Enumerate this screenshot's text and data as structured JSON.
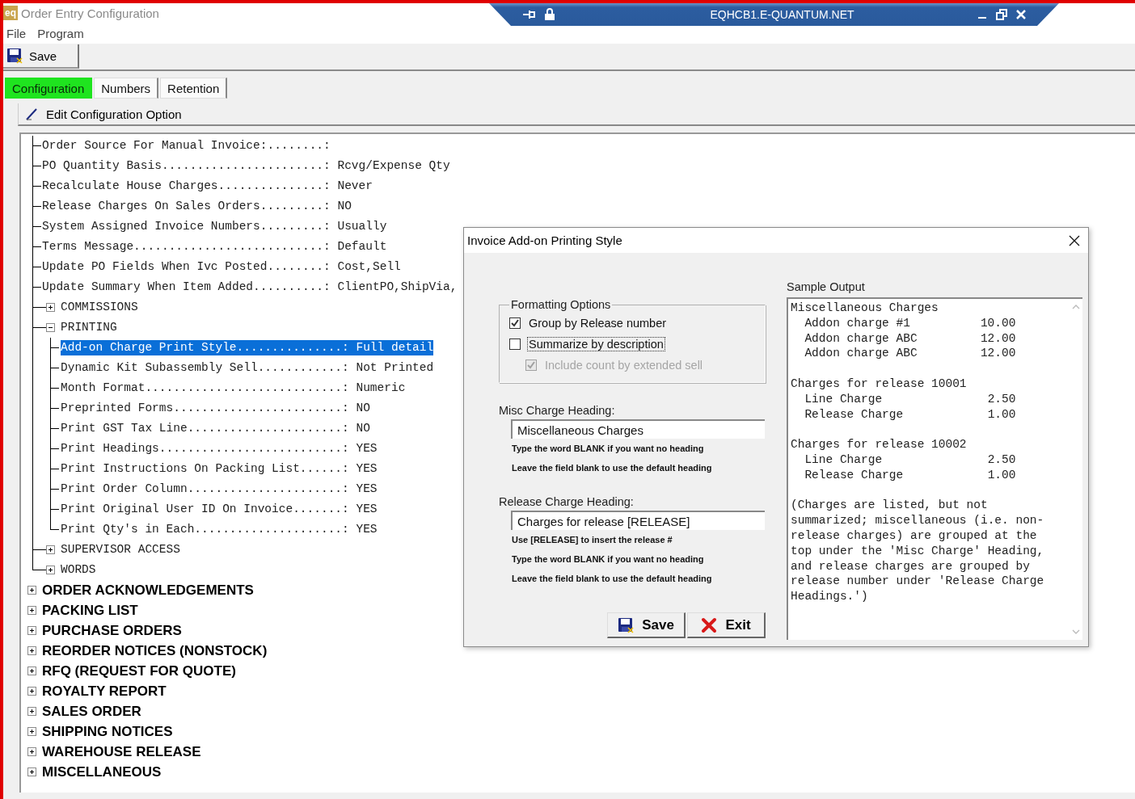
{
  "window": {
    "logo": "eq",
    "title": "Order Entry Configuration"
  },
  "remote_bar": {
    "title": "EQHCB1.E-QUANTUM.NET"
  },
  "menu": [
    "File",
    "Program"
  ],
  "toolbar": {
    "save": "Save"
  },
  "tabs": [
    {
      "label": "Configuration",
      "selected": true
    },
    {
      "label": "Numbers",
      "selected": false
    },
    {
      "label": "Retention",
      "selected": false
    }
  ],
  "edit_bar": {
    "label": "Edit Configuration Option"
  },
  "tree": {
    "branch": [
      {
        "kind": "setting",
        "label": "Order Source For Manual Invoice:........:",
        "selected": false
      },
      {
        "kind": "setting",
        "label": "PO Quantity Basis.......................:",
        "value": "Rcvg/Expense Qty",
        "selected": false
      },
      {
        "kind": "setting",
        "label": "Recalculate House Charges...............:",
        "value": "Never",
        "selected": false
      },
      {
        "kind": "setting",
        "label": "Release Charges On Sales Orders.........:",
        "value": "NO",
        "selected": false
      },
      {
        "kind": "setting",
        "label": "System Assigned Invoice Numbers.........:",
        "value": "Usually",
        "selected": false
      },
      {
        "kind": "setting",
        "label": "Terms Message...........................:",
        "value": "Default",
        "selected": false
      },
      {
        "kind": "setting",
        "label": "Update PO Fields When Ivc Posted........:",
        "value": "Cost,Sell",
        "selected": false
      },
      {
        "kind": "setting",
        "label": "Update Summary When Item Added..........:",
        "value": "ClientPO,ShipVia,",
        "selected": false
      },
      {
        "kind": "group",
        "label": "COMMISSIONS",
        "expanded": false,
        "selected": false
      },
      {
        "kind": "group",
        "label": "PRINTING",
        "expanded": true,
        "selected": false,
        "children": [
          {
            "kind": "setting",
            "label": "Add-on Charge Print Style...............:",
            "value": "Full detail",
            "selected": true
          },
          {
            "kind": "setting",
            "label": "Dynamic Kit Subassembly Sell............:",
            "value": "Not Printed",
            "selected": false
          },
          {
            "kind": "setting",
            "label": "Month Format............................:",
            "value": "Numeric",
            "selected": false
          },
          {
            "kind": "setting",
            "label": "Preprinted Forms........................:",
            "value": "NO",
            "selected": false
          },
          {
            "kind": "setting",
            "label": "Print GST Tax Line......................:",
            "value": "NO",
            "selected": false
          },
          {
            "kind": "setting",
            "label": "Print Headings..........................:",
            "value": "YES",
            "selected": false
          },
          {
            "kind": "setting",
            "label": "Print Instructions On Packing List......:",
            "value": "YES",
            "selected": false
          },
          {
            "kind": "setting",
            "label": "Print Order Column......................:",
            "value": "YES",
            "selected": false
          },
          {
            "kind": "setting",
            "label": "Print Original User ID On Invoice.......:",
            "value": "YES",
            "selected": false
          },
          {
            "kind": "setting",
            "label": "Print Qty's in Each.....................:",
            "value": "YES",
            "selected": false
          }
        ]
      },
      {
        "kind": "group",
        "label": "SUPERVISOR ACCESS",
        "expanded": false,
        "selected": false
      },
      {
        "kind": "group",
        "label": "WORDS",
        "expanded": false,
        "selected": false
      }
    ],
    "sections": [
      {
        "label": "ORDER ACKNOWLEDGEMENTS",
        "expanded": false
      },
      {
        "label": "PACKING LIST",
        "expanded": false
      },
      {
        "label": "PURCHASE ORDERS",
        "expanded": false
      },
      {
        "label": "REORDER NOTICES (NONSTOCK)",
        "expanded": false
      },
      {
        "label": "RFQ (REQUEST FOR QUOTE)",
        "expanded": false
      },
      {
        "label": "ROYALTY REPORT",
        "expanded": false
      },
      {
        "label": "SALES ORDER",
        "expanded": false
      },
      {
        "label": "SHIPPING NOTICES",
        "expanded": false
      },
      {
        "label": "WAREHOUSE RELEASE",
        "expanded": false
      },
      {
        "label": "MISCELLANEOUS",
        "expanded": false
      }
    ]
  },
  "dialog": {
    "title": "Invoice Add-on Printing Style",
    "formatting": {
      "legend": "Formatting Options",
      "options": [
        {
          "label": "Group by Release number",
          "checked": true,
          "disabled": false,
          "focused": false
        },
        {
          "label": "Summarize by description",
          "checked": false,
          "disabled": false,
          "focused": true,
          "children": [
            {
              "label": "Include count by extended sell",
              "checked": true,
              "disabled": true,
              "focused": false
            }
          ]
        }
      ]
    },
    "headings": [
      {
        "label": "Misc Charge Heading:",
        "value": "Miscellaneous Charges",
        "hints": [
          "Type the word BLANK if you want no heading",
          "Leave the field blank to use the default heading"
        ]
      },
      {
        "label": "Release Charge Heading:",
        "value": "Charges for release [RELEASE]",
        "hints": [
          "Use [RELEASE] to insert the release #",
          "Type the word BLANK if you want no heading",
          "Leave the field blank to use the default heading"
        ]
      }
    ],
    "buttons": [
      {
        "kind": "save",
        "label": "Save"
      },
      {
        "kind": "exit",
        "label": "Exit"
      }
    ],
    "sample_output": {
      "label": "Sample Output",
      "groups": [
        {
          "heading": "Miscellaneous Charges",
          "lines": [
            {
              "description": "Addon charge #1",
              "amount": "10.00"
            },
            {
              "description": "Addon charge ABC",
              "amount": "12.00"
            },
            {
              "description": "Addon charge ABC",
              "amount": "12.00"
            }
          ]
        },
        {
          "heading": "Charges for release 10001",
          "lines": [
            {
              "description": "Line Charge",
              "amount": "2.50"
            },
            {
              "description": "Release Charge",
              "amount": "1.00"
            }
          ]
        },
        {
          "heading": "Charges for release 10002",
          "lines": [
            {
              "description": "Line Charge",
              "amount": "2.50"
            },
            {
              "description": "Release Charge",
              "amount": "1.00"
            }
          ]
        }
      ],
      "note": "(Charges are listed, but not summarized; miscellaneous (i.e. non-release charges) are grouped at the top under the 'Misc Charge' Heading, and release charges are grouped by release number under 'Release Charge Headings.')"
    }
  }
}
